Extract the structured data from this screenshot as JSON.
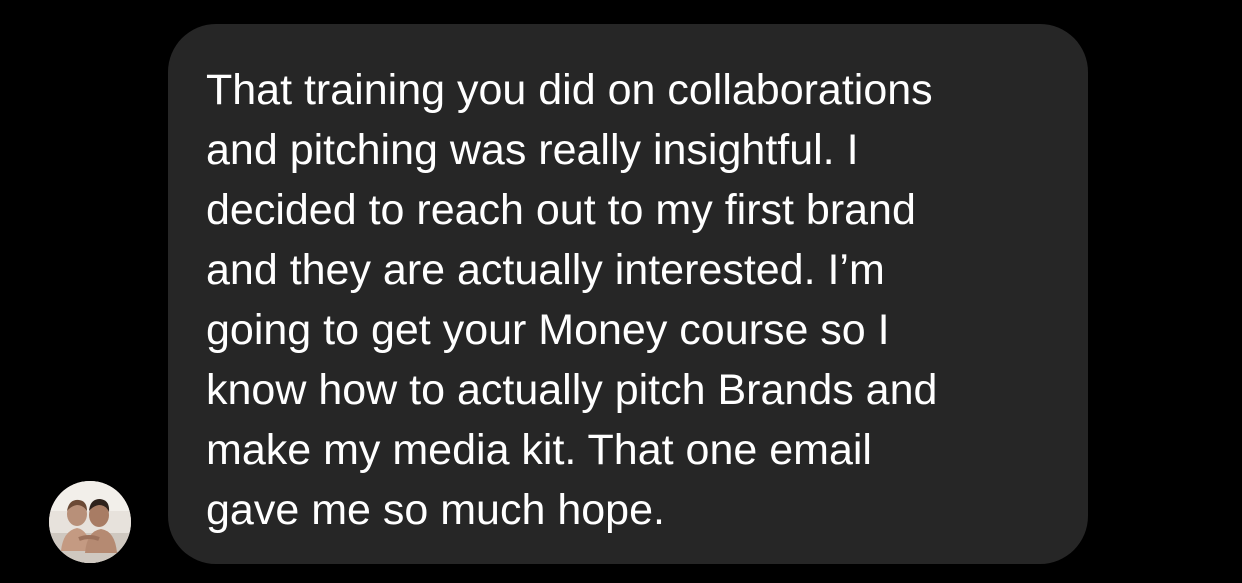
{
  "conversation": {
    "message": {
      "text": "That training you did on collaborations\nand pitching was really insightful. I\ndecided to reach out to my first brand\nand they are actually interested. I’m\ngoing to get your Money course so I\nknow how to actually pitch Brands and\nmake my media kit. That one email\ngave me so much hope.",
      "sender_avatar_icon": "sender-avatar-photo"
    }
  },
  "colors": {
    "background": "#000000",
    "bubble": "#262626",
    "text": "#ffffff"
  }
}
